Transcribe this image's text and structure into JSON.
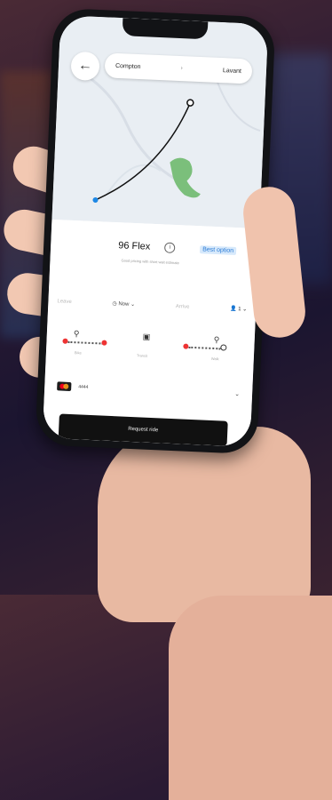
{
  "trip": {
    "origin": "Compton",
    "destination": "Lavant",
    "separator": "›"
  },
  "ride": {
    "name": "96 Flex",
    "badge": "Best option",
    "subtitle": "Good pricing with short wait estimate"
  },
  "options": {
    "pickup_label": "Leave",
    "time": "Now",
    "dropoff_label": "Arrive",
    "riders": "1"
  },
  "modes": {
    "bike_label": "Bike",
    "transit_label": "Transit",
    "walk_label": "Walk"
  },
  "payment": {
    "card_number": "4444"
  },
  "actions": {
    "request": "Request ride"
  },
  "colors": {
    "route_dot_start": "#1e88e5",
    "accent_blue": "#2a7bd6",
    "park_green": "#7bbf7b"
  }
}
